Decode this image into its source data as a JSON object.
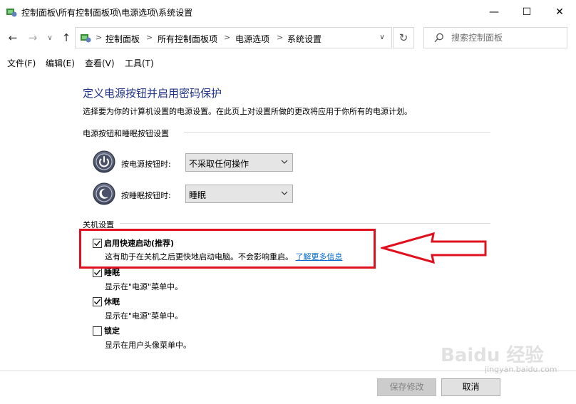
{
  "window": {
    "title": "控制面板\\所有控制面板项\\电源选项\\系统设置",
    "minimize_glyph": "—",
    "maximize_glyph": "☐",
    "close_glyph": "✕"
  },
  "nav": {
    "back_glyph": "←",
    "forward_glyph": "→",
    "history_glyph": "∨",
    "up_glyph": "↑",
    "breadcrumbs": [
      "控制面板",
      "所有控制面板项",
      "电源选项",
      "系统设置"
    ],
    "separator": ">",
    "refresh_glyph": "↻"
  },
  "search": {
    "placeholder": "搜索控制面板"
  },
  "menu": [
    "文件(F)",
    "编辑(E)",
    "查看(V)",
    "工具(T)"
  ],
  "page": {
    "title": "定义电源按钮并启用密码保护",
    "description": "选择要为你的计算机设置的电源设置。在此页上对设置所做的更改将应用于你所有的电源计划。"
  },
  "buttons_section": {
    "heading": "电源按钮和睡眠按钮设置",
    "power_button_label": "按电源按钮时:",
    "power_button_value": "不采取任何操作",
    "sleep_button_label": "按睡眠按钮时:",
    "sleep_button_value": "睡眠"
  },
  "shutdown_section": {
    "heading": "关机设置",
    "options": [
      {
        "label": "启用快速启动(推荐)",
        "desc": "这有助于在关机之后更快地启动电脑。不会影响重启。",
        "link": "了解更多信息",
        "checked": true
      },
      {
        "label": "睡眠",
        "desc": "显示在\"电源\"菜单中。",
        "checked": true
      },
      {
        "label": "休眠",
        "desc": "显示在\"电源\"菜单中。",
        "checked": true
      },
      {
        "label": "锁定",
        "desc": "显示在用户头像菜单中。",
        "checked": false
      }
    ]
  },
  "footer": {
    "save_label": "保存修改",
    "cancel_label": "取消"
  },
  "watermark": {
    "text": "Baidu 经验",
    "sub": "jingyan.baidu.com"
  },
  "colors": {
    "title_blue": "#1e3287",
    "annotation_red": "#e0101f",
    "link_blue": "#0066cc"
  }
}
